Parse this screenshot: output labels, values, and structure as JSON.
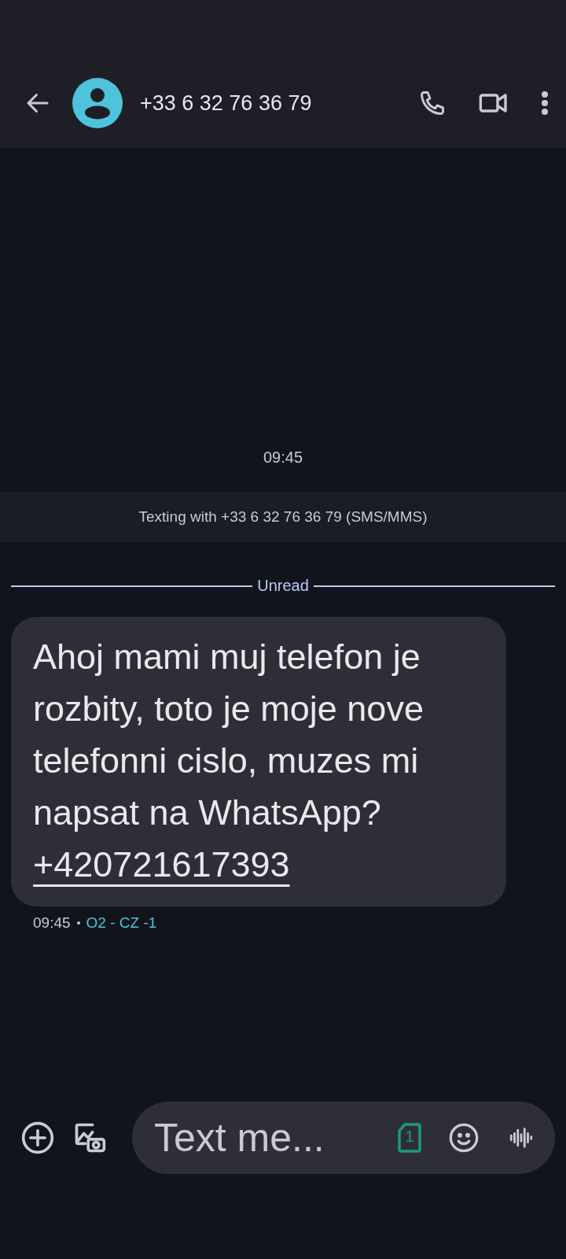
{
  "header": {
    "contact": "+33 6 32 76 36 79"
  },
  "thread": {
    "timestamp": "09:45",
    "banner": "Texting with +33 6 32 76 36 79 (SMS/MMS)",
    "divider": "Unread",
    "message": {
      "text": "Ahoj mami muj telefon je rozbity, toto je moje nove telefonni cislo, muzes mi napsat na WhatsApp?",
      "link": "+420721617393",
      "time": "09:45",
      "sim": "O2 - CZ -1"
    }
  },
  "compose": {
    "placeholder": "Text me...",
    "sim_slot": "1"
  }
}
